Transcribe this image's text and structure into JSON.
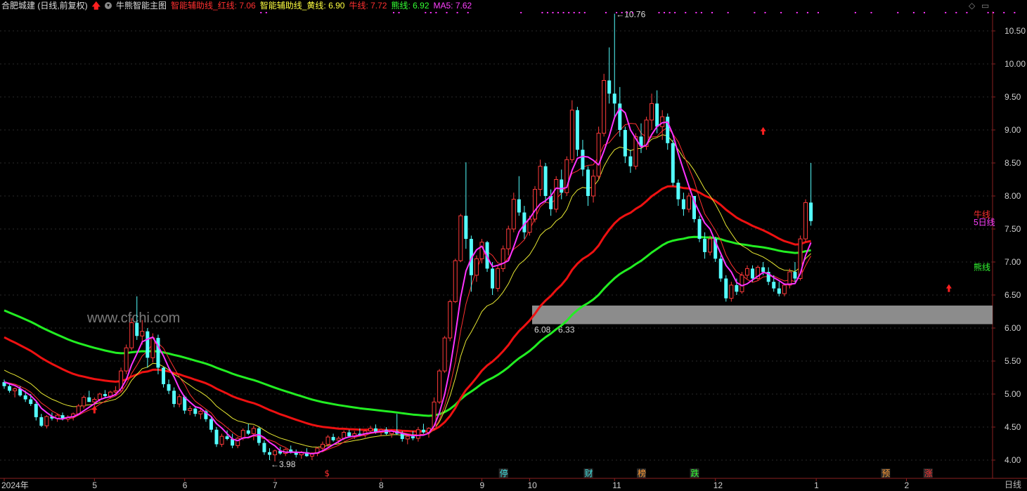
{
  "header": {
    "stock_name": "合肥城建 (日线,前复权)",
    "indicator_name": "牛熊智能主图",
    "items": [
      {
        "label": "智能辅助线_红线: 7.06",
        "color": "#ff3030"
      },
      {
        "label": "智能辅助线_黄线: 6.90",
        "color": "#ffff40"
      },
      {
        "label": "牛线: 7.72",
        "color": "#ff3030"
      },
      {
        "label": "熊线: 6.92",
        "color": "#33ff33"
      },
      {
        "label": "MA5: 7.62",
        "color": "#ff40ff"
      }
    ],
    "period_label": "日线"
  },
  "watermark": "www.cfchi.com",
  "chart_data": {
    "type": "candlestick",
    "y_ticks": [
      "10.50",
      "10.00",
      "9.50",
      "9.00",
      "8.50",
      "8.00",
      "7.50",
      "7.00",
      "6.50",
      "6.00",
      "5.50",
      "5.00",
      "4.50",
      "4.00"
    ],
    "y_range": [
      3.9,
      10.75
    ],
    "x_labels": [
      {
        "label": "2024年",
        "index": 0
      },
      {
        "label": "5",
        "index": 17
      },
      {
        "label": "6",
        "index": 34
      },
      {
        "label": "7",
        "index": 51
      },
      {
        "label": "8",
        "index": 71
      },
      {
        "label": "9",
        "index": 90
      },
      {
        "label": "10",
        "index": 99
      },
      {
        "label": "11",
        "index": 115
      },
      {
        "label": "12",
        "index": 134
      },
      {
        "label": "1",
        "index": 153
      },
      {
        "label": "2",
        "index": 170
      }
    ],
    "max_label": "10.76",
    "min_label": "3.98",
    "zone": {
      "low": 6.08,
      "high": 6.33,
      "label": "6.08 - 6.33"
    },
    "line_end_labels": [
      {
        "text": "牛线",
        "color": "#ff3030",
        "value": 7.72
      },
      {
        "text": "5日线",
        "color": "#ff40ff",
        "value": 7.6
      },
      {
        "text": "熊线",
        "color": "#33ff33",
        "value": 6.92
      }
    ],
    "bottom_tags": [
      {
        "text": "$",
        "index": 61,
        "color": "#ff3030"
      },
      {
        "text": "停",
        "index": 94,
        "color": "#40e0e0"
      },
      {
        "text": "财",
        "index": 110,
        "color": "#40e0e0"
      },
      {
        "text": "榜",
        "index": 120,
        "color": "#ff9933"
      },
      {
        "text": "跌",
        "index": 130,
        "color": "#33ff33"
      },
      {
        "text": "预",
        "index": 166,
        "color": "#ff9933"
      },
      {
        "text": "涨",
        "index": 174,
        "color": "#ff3030"
      }
    ],
    "ohlc": [
      [
        5.18,
        5.22,
        5.08,
        5.12
      ],
      [
        5.12,
        5.15,
        5.02,
        5.05
      ],
      [
        5.05,
        5.1,
        4.95,
        5.08
      ],
      [
        5.08,
        5.12,
        4.96,
        4.98
      ],
      [
        4.98,
        5.05,
        4.88,
        4.92
      ],
      [
        4.92,
        5.0,
        4.82,
        4.85
      ],
      [
        4.85,
        4.88,
        4.6,
        4.65
      ],
      [
        4.65,
        4.7,
        4.5,
        4.52
      ],
      [
        4.52,
        4.68,
        4.48,
        4.66
      ],
      [
        4.66,
        4.72,
        4.6,
        4.63
      ],
      [
        4.63,
        4.7,
        4.58,
        4.68
      ],
      [
        4.68,
        4.72,
        4.6,
        4.62
      ],
      [
        4.62,
        4.68,
        4.58,
        4.65
      ],
      [
        4.65,
        4.72,
        4.6,
        4.7
      ],
      [
        4.7,
        4.85,
        4.68,
        4.82
      ],
      [
        4.82,
        4.98,
        4.78,
        4.95
      ],
      [
        4.95,
        5.05,
        4.9,
        4.88
      ],
      [
        4.88,
        4.95,
        4.8,
        4.92
      ],
      [
        4.92,
        5.02,
        4.88,
        5.0
      ],
      [
        5.0,
        5.06,
        4.94,
        4.97
      ],
      [
        4.97,
        5.05,
        4.93,
        5.03
      ],
      [
        5.03,
        5.12,
        4.98,
        5.05
      ],
      [
        5.05,
        5.4,
        5.02,
        5.35
      ],
      [
        5.35,
        5.75,
        5.3,
        5.7
      ],
      [
        5.7,
        6.15,
        5.66,
        6.08
      ],
      [
        6.08,
        6.48,
        5.82,
        5.88
      ],
      [
        5.88,
        6.12,
        5.75,
        5.95
      ],
      [
        5.95,
        6.0,
        5.4,
        5.55
      ],
      [
        5.55,
        5.92,
        5.48,
        5.85
      ],
      [
        5.85,
        5.9,
        5.3,
        5.4
      ],
      [
        5.4,
        5.42,
        5.1,
        5.15
      ],
      [
        5.15,
        5.22,
        5.0,
        5.05
      ],
      [
        5.05,
        5.1,
        4.8,
        4.85
      ],
      [
        4.85,
        5.0,
        4.8,
        4.96
      ],
      [
        4.96,
        4.98,
        4.7,
        4.75
      ],
      [
        4.75,
        4.82,
        4.68,
        4.78
      ],
      [
        4.78,
        4.82,
        4.66,
        4.7
      ],
      [
        4.7,
        4.78,
        4.62,
        4.74
      ],
      [
        4.74,
        4.76,
        4.58,
        4.62
      ],
      [
        4.62,
        4.66,
        4.42,
        4.46
      ],
      [
        4.46,
        4.5,
        4.2,
        4.24
      ],
      [
        4.24,
        4.4,
        4.2,
        4.36
      ],
      [
        4.36,
        4.45,
        4.3,
        4.32
      ],
      [
        4.32,
        4.4,
        4.18,
        4.22
      ],
      [
        4.22,
        4.35,
        4.18,
        4.33
      ],
      [
        4.33,
        4.48,
        4.3,
        4.45
      ],
      [
        4.45,
        4.55,
        4.38,
        4.4
      ],
      [
        4.4,
        4.52,
        4.3,
        4.48
      ],
      [
        4.48,
        4.5,
        4.22,
        4.26
      ],
      [
        4.26,
        4.3,
        4.08,
        4.12
      ],
      [
        4.12,
        4.18,
        4.0,
        4.08
      ],
      [
        4.08,
        4.16,
        3.98,
        4.14
      ],
      [
        4.14,
        4.2,
        4.08,
        4.1
      ],
      [
        4.1,
        4.18,
        4.06,
        4.16
      ],
      [
        4.16,
        4.22,
        4.1,
        4.12
      ],
      [
        4.12,
        4.16,
        4.04,
        4.08
      ],
      [
        4.08,
        4.14,
        4.02,
        4.12
      ],
      [
        4.12,
        4.18,
        4.05,
        4.06
      ],
      [
        4.06,
        4.12,
        4.0,
        4.1
      ],
      [
        4.1,
        4.2,
        4.06,
        4.18
      ],
      [
        4.18,
        4.28,
        4.12,
        4.24
      ],
      [
        4.24,
        4.38,
        4.2,
        4.35
      ],
      [
        4.35,
        4.4,
        4.28,
        4.3
      ],
      [
        4.3,
        4.36,
        4.25,
        4.33
      ],
      [
        4.33,
        4.45,
        4.3,
        4.42
      ],
      [
        4.42,
        4.46,
        4.34,
        4.36
      ],
      [
        4.36,
        4.44,
        4.32,
        4.4
      ],
      [
        4.4,
        4.48,
        4.36,
        4.38
      ],
      [
        4.38,
        4.46,
        4.34,
        4.44
      ],
      [
        4.44,
        4.52,
        4.4,
        4.48
      ],
      [
        4.48,
        4.54,
        4.4,
        4.42
      ],
      [
        4.42,
        4.48,
        4.36,
        4.46
      ],
      [
        4.46,
        4.5,
        4.38,
        4.4
      ],
      [
        4.4,
        4.46,
        4.34,
        4.44
      ],
      [
        4.44,
        4.7,
        4.38,
        4.4
      ],
      [
        4.4,
        4.44,
        4.28,
        4.32
      ],
      [
        4.32,
        4.4,
        4.24,
        4.36
      ],
      [
        4.36,
        4.44,
        4.3,
        4.33
      ],
      [
        4.33,
        4.5,
        4.28,
        4.46
      ],
      [
        4.46,
        4.55,
        4.4,
        4.42
      ],
      [
        4.42,
        4.5,
        4.34,
        4.48
      ],
      [
        4.48,
        4.95,
        4.45,
        4.88
      ],
      [
        4.88,
        5.38,
        4.85,
        5.35
      ],
      [
        5.35,
        5.88,
        5.32,
        5.85
      ],
      [
        5.85,
        6.43,
        5.8,
        6.4
      ],
      [
        6.4,
        7.05,
        6.38,
        7.02
      ],
      [
        7.02,
        7.73,
        7.0,
        7.7
      ],
      [
        7.7,
        8.51,
        7.2,
        7.35
      ],
      [
        7.35,
        7.4,
        6.55,
        6.8
      ],
      [
        6.8,
        7.1,
        6.7,
        7.05
      ],
      [
        7.05,
        7.35,
        6.98,
        7.3
      ],
      [
        7.3,
        7.32,
        6.85,
        6.9
      ],
      [
        6.9,
        7.0,
        6.5,
        6.6
      ],
      [
        6.6,
        6.95,
        6.55,
        6.9
      ],
      [
        6.9,
        7.25,
        6.85,
        7.2
      ],
      [
        7.2,
        7.55,
        7.1,
        7.5
      ],
      [
        7.5,
        8.05,
        7.45,
        7.95
      ],
      [
        7.95,
        8.3,
        7.7,
        7.75
      ],
      [
        7.75,
        7.85,
        7.35,
        7.45
      ],
      [
        7.45,
        7.7,
        7.4,
        7.65
      ],
      [
        7.65,
        8.15,
        7.6,
        8.1
      ],
      [
        8.1,
        8.55,
        8.0,
        8.45
      ],
      [
        8.45,
        8.5,
        7.9,
        8.0
      ],
      [
        8.0,
        8.1,
        7.7,
        7.8
      ],
      [
        7.8,
        8.3,
        7.75,
        8.25
      ],
      [
        8.25,
        8.4,
        7.95,
        8.05
      ],
      [
        8.05,
        8.6,
        8.0,
        8.55
      ],
      [
        8.55,
        9.45,
        8.5,
        9.3
      ],
      [
        9.3,
        9.35,
        8.6,
        8.7
      ],
      [
        8.7,
        8.85,
        8.3,
        8.4
      ],
      [
        8.4,
        8.45,
        7.85,
        8.0
      ],
      [
        8.0,
        8.4,
        7.9,
        8.3
      ],
      [
        8.3,
        9.05,
        8.25,
        8.95
      ],
      [
        8.95,
        9.85,
        8.9,
        9.75
      ],
      [
        9.75,
        10.25,
        9.4,
        9.55
      ],
      [
        9.55,
        10.76,
        9.2,
        9.4
      ],
      [
        9.4,
        9.65,
        8.9,
        9.0
      ],
      [
        9.0,
        9.05,
        8.5,
        8.6
      ],
      [
        8.6,
        8.7,
        8.35,
        8.45
      ],
      [
        8.45,
        8.95,
        8.4,
        8.9
      ],
      [
        8.9,
        9.1,
        8.65,
        8.75
      ],
      [
        8.75,
        9.2,
        8.7,
        9.15
      ],
      [
        9.15,
        9.55,
        9.0,
        9.4
      ],
      [
        9.4,
        9.6,
        8.95,
        9.05
      ],
      [
        9.05,
        9.3,
        8.85,
        9.2
      ],
      [
        9.2,
        9.25,
        8.7,
        8.8
      ],
      [
        8.8,
        8.85,
        8.15,
        8.2
      ],
      [
        8.2,
        8.25,
        7.85,
        7.95
      ],
      [
        7.95,
        8.05,
        7.7,
        7.8
      ],
      [
        7.8,
        8.05,
        7.75,
        8.0
      ],
      [
        8.0,
        8.0,
        7.6,
        7.65
      ],
      [
        7.65,
        7.7,
        7.3,
        7.35
      ],
      [
        7.35,
        7.45,
        7.05,
        7.15
      ],
      [
        7.15,
        7.4,
        7.1,
        7.35
      ],
      [
        7.35,
        7.38,
        7.0,
        7.05
      ],
      [
        7.05,
        7.1,
        6.7,
        6.75
      ],
      [
        6.75,
        6.8,
        6.4,
        6.45
      ],
      [
        6.45,
        6.7,
        6.4,
        6.65
      ],
      [
        6.65,
        6.75,
        6.5,
        6.55
      ],
      [
        6.55,
        6.85,
        6.52,
        6.8
      ],
      [
        6.8,
        6.95,
        6.75,
        6.9
      ],
      [
        6.9,
        6.95,
        6.7,
        6.75
      ],
      [
        6.75,
        6.95,
        6.72,
        6.92
      ],
      [
        6.92,
        7.0,
        6.8,
        6.85
      ],
      [
        6.85,
        6.92,
        6.65,
        6.7
      ],
      [
        6.7,
        6.8,
        6.55,
        6.6
      ],
      [
        6.6,
        6.7,
        6.48,
        6.52
      ],
      [
        6.52,
        6.68,
        6.48,
        6.65
      ],
      [
        6.65,
        6.9,
        6.6,
        6.85
      ],
      [
        6.85,
        7.0,
        6.7,
        6.75
      ],
      [
        6.75,
        7.4,
        6.72,
        7.35
      ],
      [
        7.35,
        7.95,
        7.3,
        7.9
      ],
      [
        7.9,
        8.5,
        7.55,
        7.62
      ]
    ]
  }
}
